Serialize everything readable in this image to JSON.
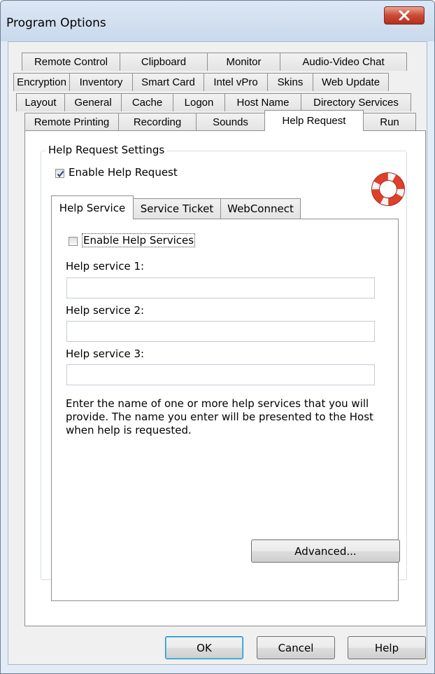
{
  "window": {
    "title": "Program Options"
  },
  "tabs": {
    "row1": [
      "Remote Control",
      "Clipboard",
      "Monitor",
      "Audio-Video Chat"
    ],
    "row2": [
      "Encryption",
      "Inventory",
      "Smart Card",
      "Intel vPro",
      "Skins",
      "Web Update"
    ],
    "row3": [
      "Layout",
      "General",
      "Cache",
      "Logon",
      "Host Name",
      "Directory Services"
    ],
    "row4": [
      "Remote Printing",
      "Recording",
      "Sounds",
      "Help Request",
      "Run"
    ],
    "active": "Help Request"
  },
  "group": {
    "label": "Help Request Settings",
    "enable_label": "Enable Help Request",
    "enable_checked": true
  },
  "inner_tabs": {
    "items": [
      "Help Service",
      "Service Ticket",
      "WebConnect"
    ],
    "active": "Help Service"
  },
  "help_service": {
    "enable_label": "Enable Help Services",
    "enable_checked": false,
    "service1_label": "Help service 1:",
    "service1_value": "",
    "service2_label": "Help service 2:",
    "service2_value": "",
    "service3_label": "Help service 3:",
    "service3_value": "",
    "description": "Enter the name of one or more help services that you will provide. The name you enter will be presented to the Host when help is requested."
  },
  "buttons": {
    "advanced": "Advanced...",
    "ok": "OK",
    "cancel": "Cancel",
    "help": "Help"
  },
  "colors": {
    "window_frame": "#e3ecf6",
    "dialog_bg": "#f0f0f0",
    "close_red": "#cc4a35",
    "default_button_border": "#3c7fb1"
  }
}
